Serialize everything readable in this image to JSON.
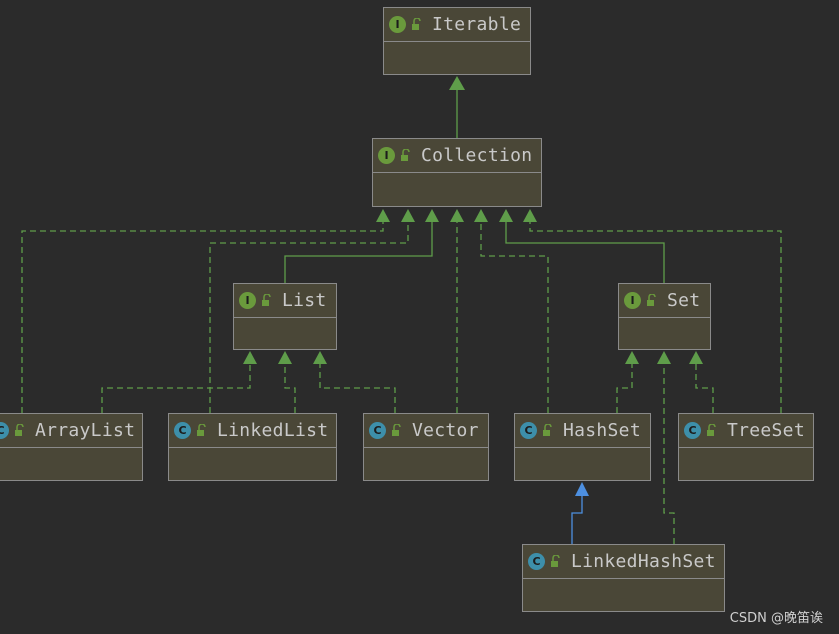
{
  "nodes": {
    "iterable": {
      "label": "Iterable",
      "kind": "I"
    },
    "collection": {
      "label": "Collection",
      "kind": "I"
    },
    "list": {
      "label": "List",
      "kind": "I"
    },
    "set": {
      "label": "Set",
      "kind": "I"
    },
    "arraylist": {
      "label": "ArrayList",
      "kind": "C"
    },
    "linkedlist": {
      "label": "LinkedList",
      "kind": "C"
    },
    "vector": {
      "label": "Vector",
      "kind": "C"
    },
    "hashset": {
      "label": "HashSet",
      "kind": "C"
    },
    "treeset": {
      "label": "TreeSet",
      "kind": "C"
    },
    "linkedhashset": {
      "label": "LinkedHashSet",
      "kind": "C"
    }
  },
  "colors": {
    "background": "#2b2b2b",
    "node_fill": "#4a4737",
    "interface_badge": "#6a9a3c",
    "class_badge": "#3d8faa",
    "extends_edge": "#5f9d4a",
    "implements_edge": "#5f9d4a",
    "class_extends_edge": "#4d8fe0"
  },
  "watermark": "CSDN @晚笛诶"
}
